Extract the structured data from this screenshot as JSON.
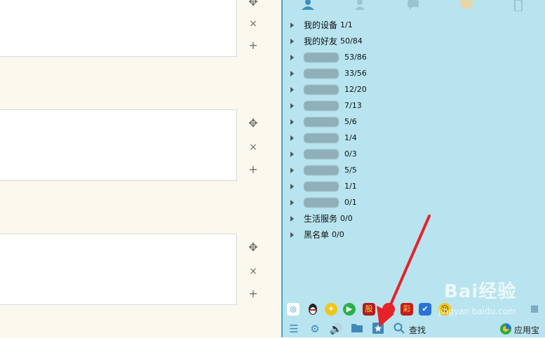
{
  "left_controls": {
    "move_icon": "✥",
    "close_icon": "×",
    "add_icon": "+"
  },
  "qq": {
    "groups": [
      {
        "name": "我的设备",
        "count": "1/1",
        "blurred": false
      },
      {
        "name": "我的好友",
        "count": "50/84",
        "blurred": false
      },
      {
        "name": "",
        "count": "53/86",
        "blurred": true
      },
      {
        "name": "",
        "count": "33/56",
        "blurred": true
      },
      {
        "name": "",
        "count": "12/20",
        "blurred": true
      },
      {
        "name": "",
        "count": "7/13",
        "blurred": true
      },
      {
        "name": "",
        "count": "5/6",
        "blurred": true
      },
      {
        "name": "",
        "count": "1/4",
        "blurred": true
      },
      {
        "name": "",
        "count": "0/3",
        "blurred": true
      },
      {
        "name": "",
        "count": "5/5",
        "blurred": true
      },
      {
        "name": "",
        "count": "1/1",
        "blurred": true
      },
      {
        "name": "",
        "count": "0/1",
        "blurred": true
      },
      {
        "name": "生活服务",
        "count": "0/0",
        "blurred": false
      },
      {
        "name": "黑名单",
        "count": "0/0",
        "blurred": false
      }
    ],
    "apps": {
      "stock_label": "股",
      "lottery_label": "彩"
    },
    "bottom": {
      "search_label": "查找",
      "appstore_label": "应用宝"
    }
  },
  "watermark": {
    "brand": "Bai经验",
    "url": "jingyan.baidu.com"
  },
  "colors": {
    "panel_bg": "#b8e4ef",
    "arrow": "#e8202a",
    "accent": "#3b8fc0"
  }
}
